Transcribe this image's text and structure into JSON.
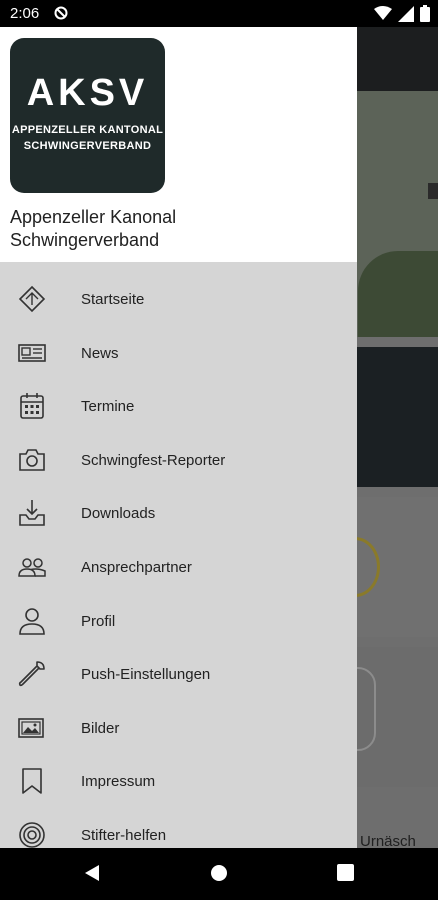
{
  "status_bar": {
    "time": "2:06",
    "icons": [
      "do-not-disturb-icon",
      "wifi-icon",
      "signal-icon",
      "battery-icon"
    ]
  },
  "drawer": {
    "logo": {
      "abbr": "AKSV",
      "line1": "APPENZELLER KANTONAL",
      "line2": "SCHWINGERVERBAND"
    },
    "org_name_line1": "Appenzeller Kanonal",
    "org_name_line2": "Schwingerverband",
    "items": [
      {
        "label": "Startseite",
        "icon": "compass-diamond-icon"
      },
      {
        "label": "News",
        "icon": "newspaper-icon"
      },
      {
        "label": "Termine",
        "icon": "calendar-icon"
      },
      {
        "label": "Schwingfest-Reporter",
        "icon": "camera-icon"
      },
      {
        "label": "Downloads",
        "icon": "download-tray-icon"
      },
      {
        "label": "Ansprechpartner",
        "icon": "people-icon"
      },
      {
        "label": "Profil",
        "icon": "person-icon"
      },
      {
        "label": "Push-Einstellungen",
        "icon": "wrench-icon"
      },
      {
        "label": "Bilder",
        "icon": "images-icon"
      },
      {
        "label": "Impressum",
        "icon": "bookmark-icon"
      },
      {
        "label": "Stifter-helfen",
        "icon": "target-icon"
      }
    ]
  },
  "background": {
    "visible_text": "Urnäsch"
  },
  "nav_bar": {
    "buttons": [
      "back-icon",
      "home-icon",
      "recents-icon"
    ]
  }
}
